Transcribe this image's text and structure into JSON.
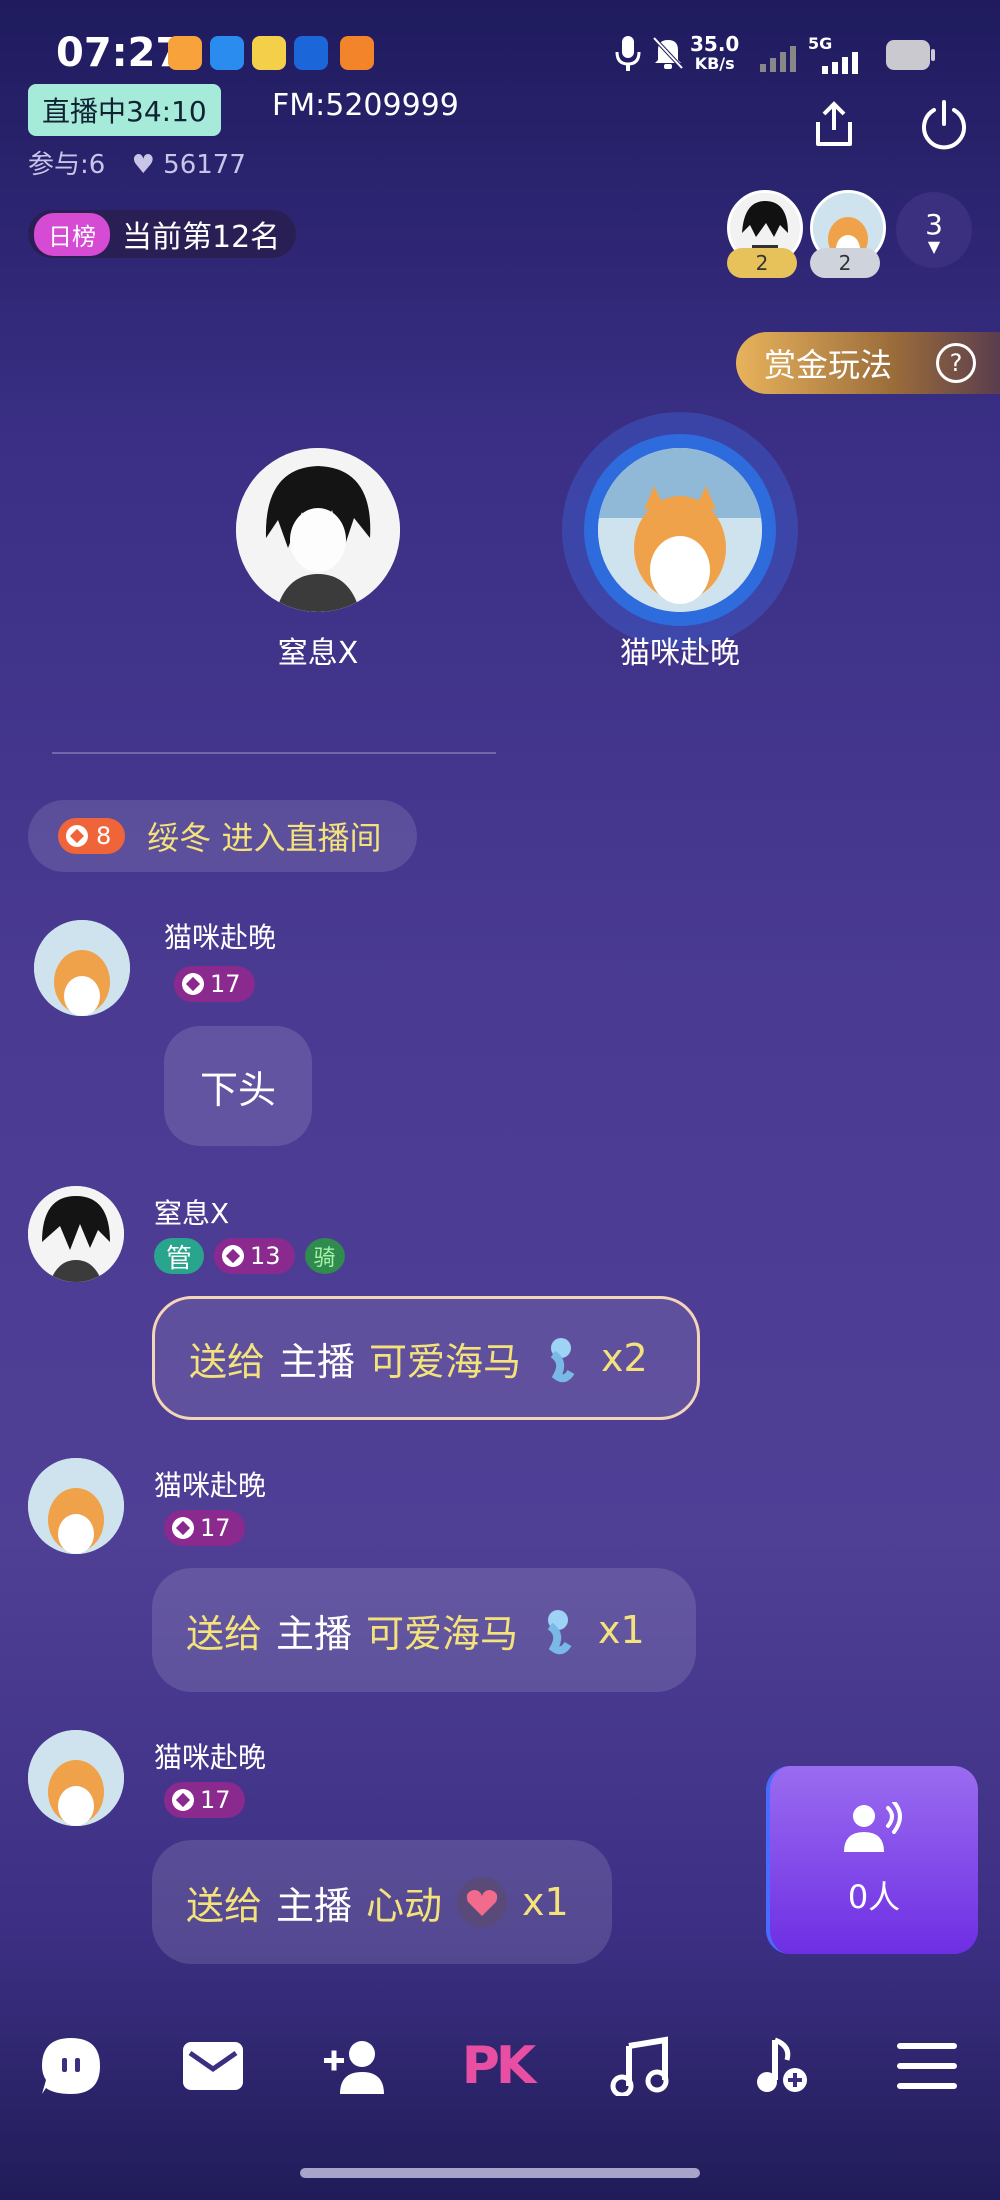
{
  "status_bar": {
    "time": "07:27",
    "net_speed_value": "35.0",
    "net_speed_unit": "KB/s",
    "network": "5G"
  },
  "header": {
    "live_label": "直播中34:10",
    "fm_label": "FM:5209999",
    "participants": "参与:6",
    "likes": "56177",
    "rank_tag": "日榜",
    "rank_text": "当前第12名",
    "top_badges": [
      "2",
      "2"
    ],
    "viewer_count": "3"
  },
  "bounty": {
    "label": "赏金玩法",
    "help": "?"
  },
  "stage": [
    {
      "name": "窒息X"
    },
    {
      "name": "猫咪赴晚"
    }
  ],
  "enter_message": {
    "level": "8",
    "text": "绥冬 进入直播间"
  },
  "messages": [
    {
      "user": "猫咪赴晚",
      "level": "17",
      "text": "下头"
    },
    {
      "user": "窒息X",
      "manager_tag": "管",
      "level": "13",
      "ride_tag": "骑",
      "gift_prefix": "送给",
      "gift_target": "主播",
      "gift_name": "可爱海马",
      "gift_count": "x2"
    },
    {
      "user": "猫咪赴晚",
      "level": "17",
      "gift_prefix": "送给",
      "gift_target": "主播",
      "gift_name": "可爱海马",
      "gift_count": "x1"
    },
    {
      "user": "猫咪赴晚",
      "level": "17",
      "gift_prefix": "送给",
      "gift_target": "主播",
      "gift_name": "心动",
      "gift_count": "x1"
    }
  ],
  "voice_card": {
    "label": "0人"
  },
  "bottom_nav": [
    "chat-icon",
    "mail-icon",
    "add-friend-icon",
    "pk-icon",
    "music-icon",
    "add-music-icon",
    "menu-icon"
  ],
  "bottom_nav_pk_label": "PK",
  "colors": {
    "accent_yellow": "#f4e27a",
    "live_badge": "#a6ebd9",
    "voice_card": "#7b3ef0"
  }
}
